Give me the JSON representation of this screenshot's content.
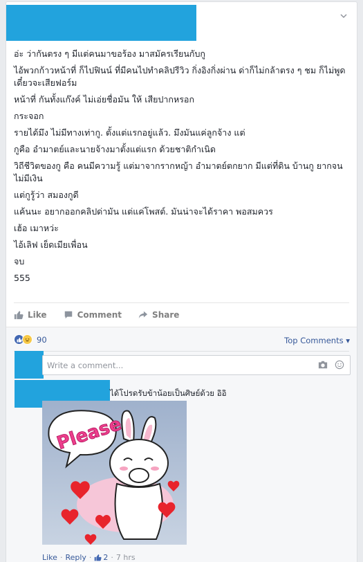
{
  "post": {
    "lines": [
      "อ่ะ ว่ากันตรง ๆ มีแต่คนมาขอร้อง มาสมัครเรียนกับกู",
      "ไอ้พวกก้าวหน้าที่ ก็ไปฟินน์ ที่มีคนไปทำคลิปรีวิว กิ่งอิงกิ่งผ่าน ด่าก็ไม่กล้าตรง ๆ ชม ก็ไม่พูด เดี๋ยวจะเสียฟอร์ม",
      "หน้าที่ กันทั้งแก๊งค์ ไม่เอ่ยชื่อมัน ให้ เสียปากหรอก",
      "กระจอก",
      "รายได้มึง ไม่มีทางเท่ากู. ตั้งแต่แรกอยู่แล้ว. มึงมันแค่ลูกจ้าง แต่",
      "กูคือ อำมาตย์และนายจ้างมาตั้งแต่แรก ด้วยชาติกำเนิด",
      "วิถีชีวิตของกู คือ คนมีความรู้ แต่มาจากรากหญ้า อำมาตย์ตกยาก มีแต่ที่ดิน บ้านกู ยากจน ไม่มีเงิน",
      "แต่กูรู้ว่า สมองกูดี",
      "แค้นนะ อยากออกคลิปด่ามัน แต่แค่โพสต์. มันน่าจะได้ราคา พอสมควร",
      "เฮ้อ เมาหว่ะ",
      "ไอ้เลิฟ เย็ดเมียเพื่อน",
      "จบ",
      "555"
    ]
  },
  "actions": {
    "like": "Like",
    "comment": "Comment",
    "share": "Share"
  },
  "reactions": {
    "count": "90",
    "like_glyph": "👍",
    "haha_glyph": "😆"
  },
  "top_comments": "Top Comments ▾",
  "comment_box": {
    "placeholder": "Write a comment..."
  },
  "comment": {
    "text": "ได้โปรดรับข้าน้อยเป็นศิษย์ด้วย อิอิ",
    "sticker_word": "Please",
    "like": "Like",
    "reply": "Reply",
    "likes_count": "2",
    "time": "7 hrs"
  },
  "colors": {
    "redaction": "#22a3dd",
    "link": "#365899",
    "like_blue": "#4267b2"
  }
}
